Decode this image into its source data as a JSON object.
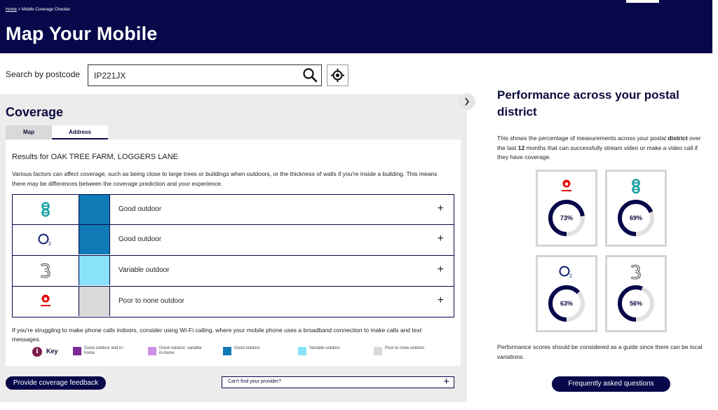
{
  "header": {
    "breadcrumb_home": "Home",
    "breadcrumb_sep": ">",
    "breadcrumb_current": "Mobile Coverage Checker",
    "title": "Map Your Mobile",
    "background": "#07084a"
  },
  "search": {
    "label": "Search by postcode",
    "value": "IP221JX",
    "search_icon": "magnifier-icon",
    "locate_icon": "crosshair-location-icon"
  },
  "coverage": {
    "title": "Coverage",
    "tabs": [
      {
        "label": "Map",
        "active": false
      },
      {
        "label": "Address",
        "active": true
      }
    ],
    "results_text": "Results for OAK TREE FARM, LOGGERS LANE",
    "description": "Various factors can affect coverage, such as being close to large trees or buildings when outdoors, or the thickness of walls if you're inside a building. This means there may be differences between the coverage prediction and your experience.",
    "providers": [
      {
        "name": "EE",
        "status": "Good outdoor",
        "color": "#0f7ab5"
      },
      {
        "name": "O2",
        "status": "Good outdoor",
        "color": "#0f7ab5"
      },
      {
        "name": "Three",
        "status": "Variable outdoor",
        "color": "#88e3fa"
      },
      {
        "name": "Vodafone",
        "status": "Poor to none outdoor",
        "color": "#d9d9d9"
      }
    ],
    "expand_symbol": "+",
    "wifi_note": "If you're struggling to make phone calls indoors, consider using Wi-Fi calling, where your mobile phone uses a broadband connection to make calls and text messages.",
    "key": {
      "label": "Key",
      "items": [
        {
          "label": "Good outdoor and in-home",
          "color": "#7b2a98"
        },
        {
          "label": "Good outdoor, variable in-home",
          "color": "#cf8ee6"
        },
        {
          "label": "Good outdoor",
          "color": "#0f7ab5"
        },
        {
          "label": "Variable outdoor",
          "color": "#88e3fa"
        },
        {
          "label": "Poor to none outdoor",
          "color": "#d9d9d9"
        }
      ]
    },
    "feedback_button": "Provide coverage feedback",
    "provider_prompt": "Can't find your provider?"
  },
  "performance": {
    "title": "Performance across your postal district",
    "intro_1": "This shows the percentage of measurements across your postal ",
    "intro_bold_1": "district",
    "intro_2": " over the last ",
    "intro_bold_2": "12",
    "intro_3": " months that can successfully stream video or make a video call if they have coverage.",
    "cards": [
      {
        "provider": "Vodafone",
        "percent": 73,
        "label": "73%"
      },
      {
        "provider": "EE",
        "percent": 69,
        "label": "69%"
      },
      {
        "provider": "O2",
        "percent": 63,
        "label": "63%"
      },
      {
        "provider": "Three",
        "percent": 56,
        "label": "56%"
      }
    ],
    "ring_color": "#07084a",
    "ring_track": "#e3e0e0",
    "note": "Performance scores should be considered as a guide since there can be local variations.",
    "faq_button": "Frequently asked questions"
  }
}
